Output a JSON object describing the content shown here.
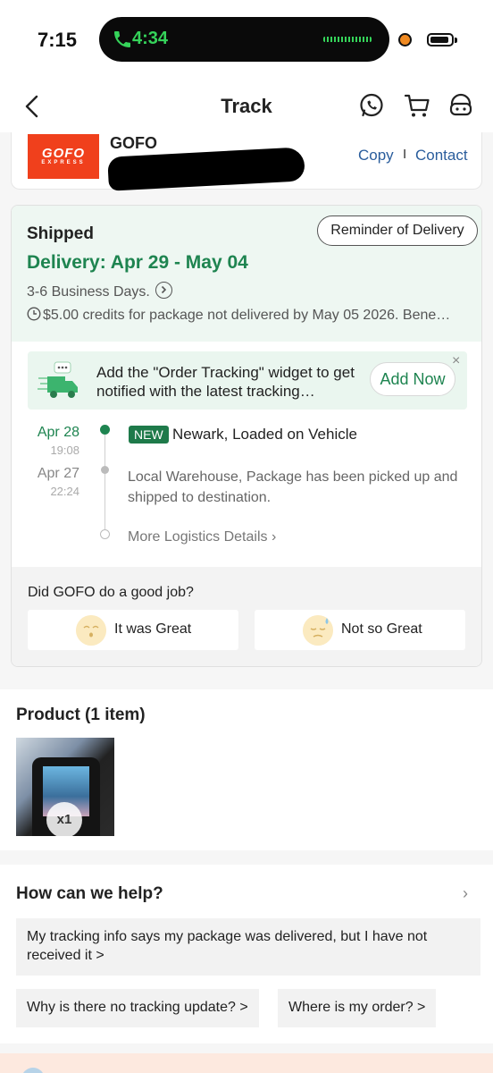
{
  "status_bar": {
    "time": "7:15",
    "call_timer": "4:34",
    "battery_level": 0.9
  },
  "nav": {
    "title": "Track"
  },
  "courier": {
    "name": "GOFO",
    "logo_text": "GOFO",
    "logo_subtext": "EXPRESS",
    "copy_label": "Copy",
    "separator": "I",
    "contact_label": "Contact"
  },
  "shipment": {
    "status": "Shipped",
    "reminder_label": "Reminder of Delivery",
    "delivery_window": "Delivery: Apr 29 - May 04",
    "business_days": "3-6 Business Days.",
    "credits_note": "$5.00 credits for package not delivered by May 05 2026. Bene…"
  },
  "widget_banner": {
    "text": "Add the \"Order Tracking\" widget to get notified with the latest tracking…",
    "add_label": "Add Now",
    "close": "×"
  },
  "timeline": [
    {
      "date": "Apr 28",
      "time": "19:08",
      "badge": "NEW",
      "event": "Newark, Loaded on Vehicle"
    },
    {
      "date": "Apr 27",
      "time": "22:24",
      "event": "Local Warehouse, Package has been picked up and shipped to destination."
    }
  ],
  "more_logistics": "More Logistics Details ›",
  "feedback": {
    "question": "Did GOFO do a good job?",
    "great_label": "It was Great",
    "not_great_label": "Not so Great"
  },
  "product": {
    "title": "Product (1 item)",
    "quantity": "x1"
  },
  "help": {
    "title": "How can we help?",
    "chevron": "›",
    "faqs": [
      "My tracking info says my package was delivered, but I have not received it >",
      "Why is there no tracking update? >",
      "Where is my order? >"
    ]
  },
  "colors": {
    "accent_green": "#1e8450",
    "link_blue": "#2a5d9c",
    "brand_orange": "#f0401c"
  }
}
